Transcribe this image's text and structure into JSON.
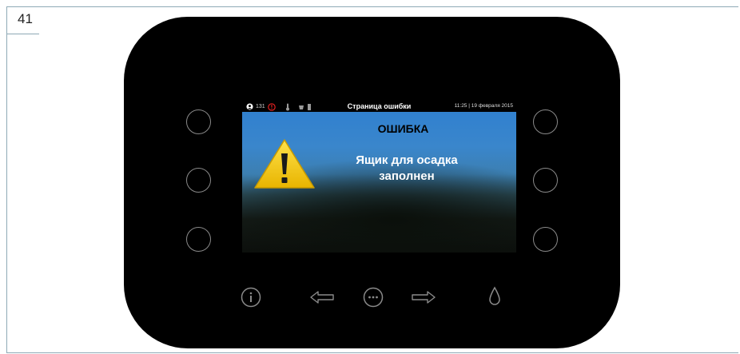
{
  "page": {
    "number": "41"
  },
  "screen": {
    "status_bar": {
      "counter": "131",
      "title": "Страница ошибки",
      "datetime": "11:25 | 19 февраля 2015"
    },
    "error": {
      "heading": "ОШИБКА",
      "message": "Ящик для осадка\nзаполнен"
    }
  },
  "device": {
    "left_buttons": [
      "left-button-1",
      "left-button-2",
      "left-button-3"
    ],
    "right_buttons": [
      "right-button-1",
      "right-button-2",
      "right-button-3"
    ],
    "bottom_buttons": [
      {
        "name": "info-button",
        "icon": "info-icon"
      },
      {
        "name": "arrow-left-button",
        "icon": "arrow-left-icon"
      },
      {
        "name": "more-button",
        "icon": "more-dots-icon"
      },
      {
        "name": "arrow-right-button",
        "icon": "arrow-right-icon"
      },
      {
        "name": "water-drop-button",
        "icon": "water-drop-icon"
      }
    ]
  },
  "colors": {
    "device_body": "#000000",
    "screen_blue": "#3a86cc",
    "warning_yellow": "#f5c400",
    "button_outline": "#8a8a8a"
  }
}
